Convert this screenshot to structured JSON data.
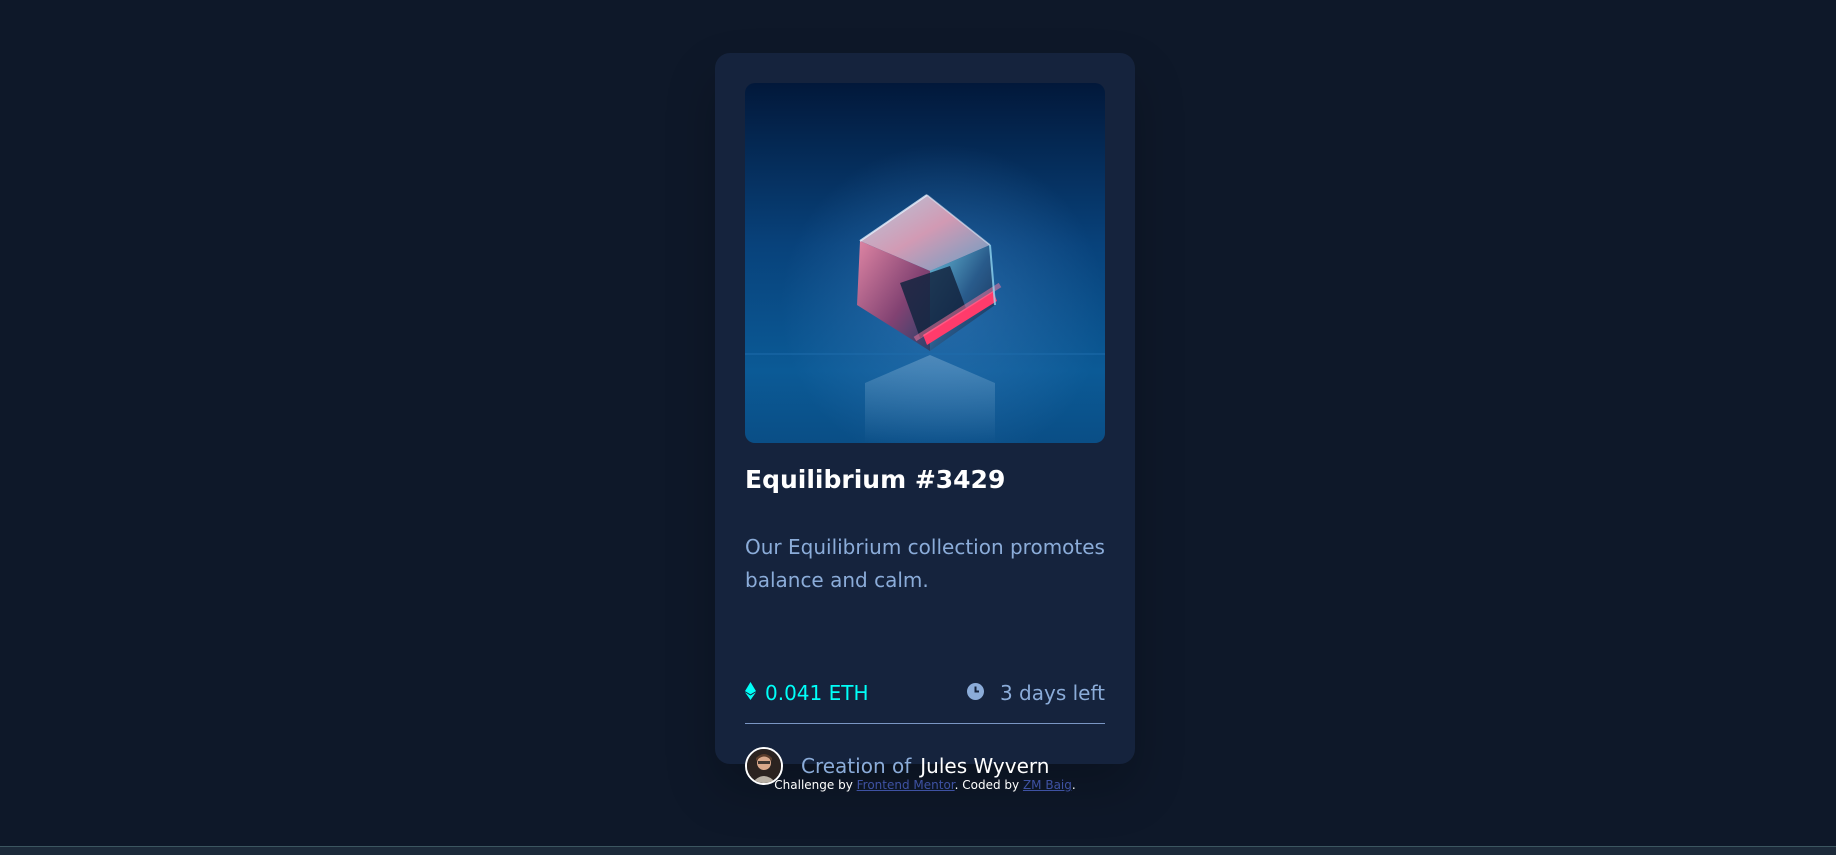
{
  "card": {
    "title": "Equilibrium #3429",
    "description": "Our Equilibrium collection promotes balance and calm.",
    "price": "0.041 ETH",
    "time_left": "3 days left",
    "price_icon": "ethereum-icon",
    "time_icon": "clock-icon",
    "creator_label": "Creation of",
    "creator_name": "Jules Wyvern"
  },
  "attribution": {
    "prefix": "Challenge by",
    "link1": "Frontend Mentor",
    "middle": ". Coded by",
    "link2": "ZM Baig",
    "suffix": "."
  },
  "colors": {
    "page_bg": "#0e1829",
    "card_bg": "#15233d",
    "accent_cyan": "#00fff8",
    "soft_blue": "#8bacd9",
    "link_blue": "#3e52a3"
  }
}
